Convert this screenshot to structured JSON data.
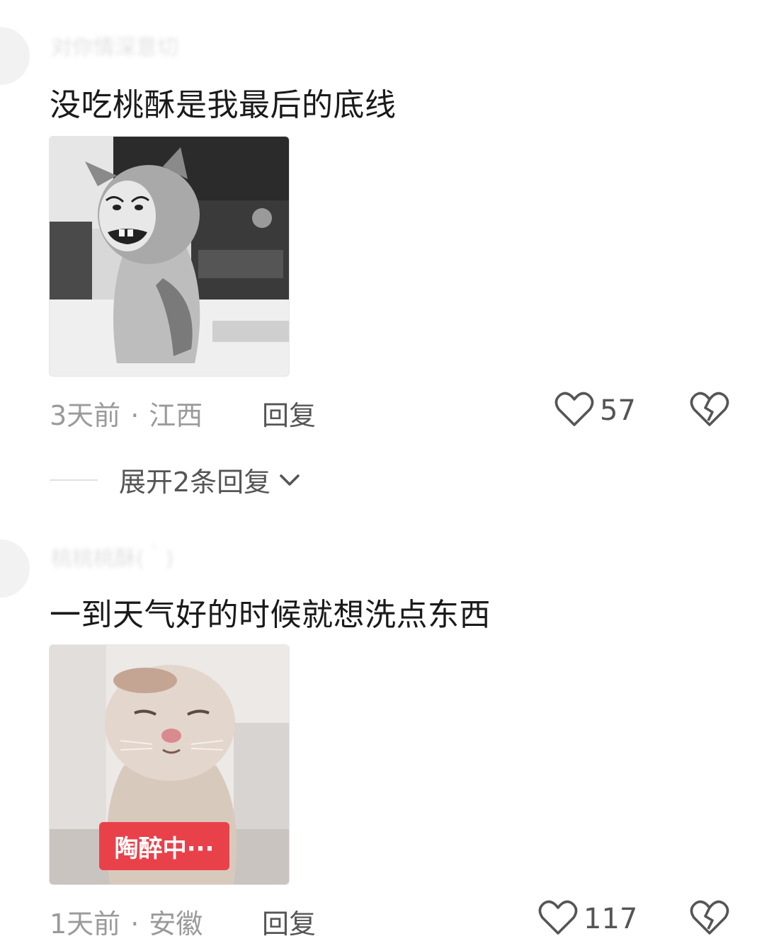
{
  "comments": [
    {
      "username": "对你情深意切",
      "text": "没吃桃酥是我最后的底线",
      "image": "cat-meme-crying-face",
      "time": "3天前",
      "location": "江西",
      "reply_label": "回复",
      "likes": "57",
      "expand_label": "展开2条回复"
    },
    {
      "username": "桃桃桃酥(｀)",
      "text": "一到天气好的时候就想洗点东西",
      "image": "wet-cat-bath",
      "image_caption": "陶醉中···",
      "time": "1天前",
      "location": "安徽",
      "reply_label": "回复",
      "likes": "117"
    }
  ],
  "icons": {
    "like": "heart-outline-icon",
    "dislike": "broken-heart-icon",
    "expand": "chevron-down-icon"
  },
  "colors": {
    "text": "#1a1a1a",
    "meta": "#9a9a9a",
    "action": "#555555",
    "tag_red": "#e9414a"
  }
}
